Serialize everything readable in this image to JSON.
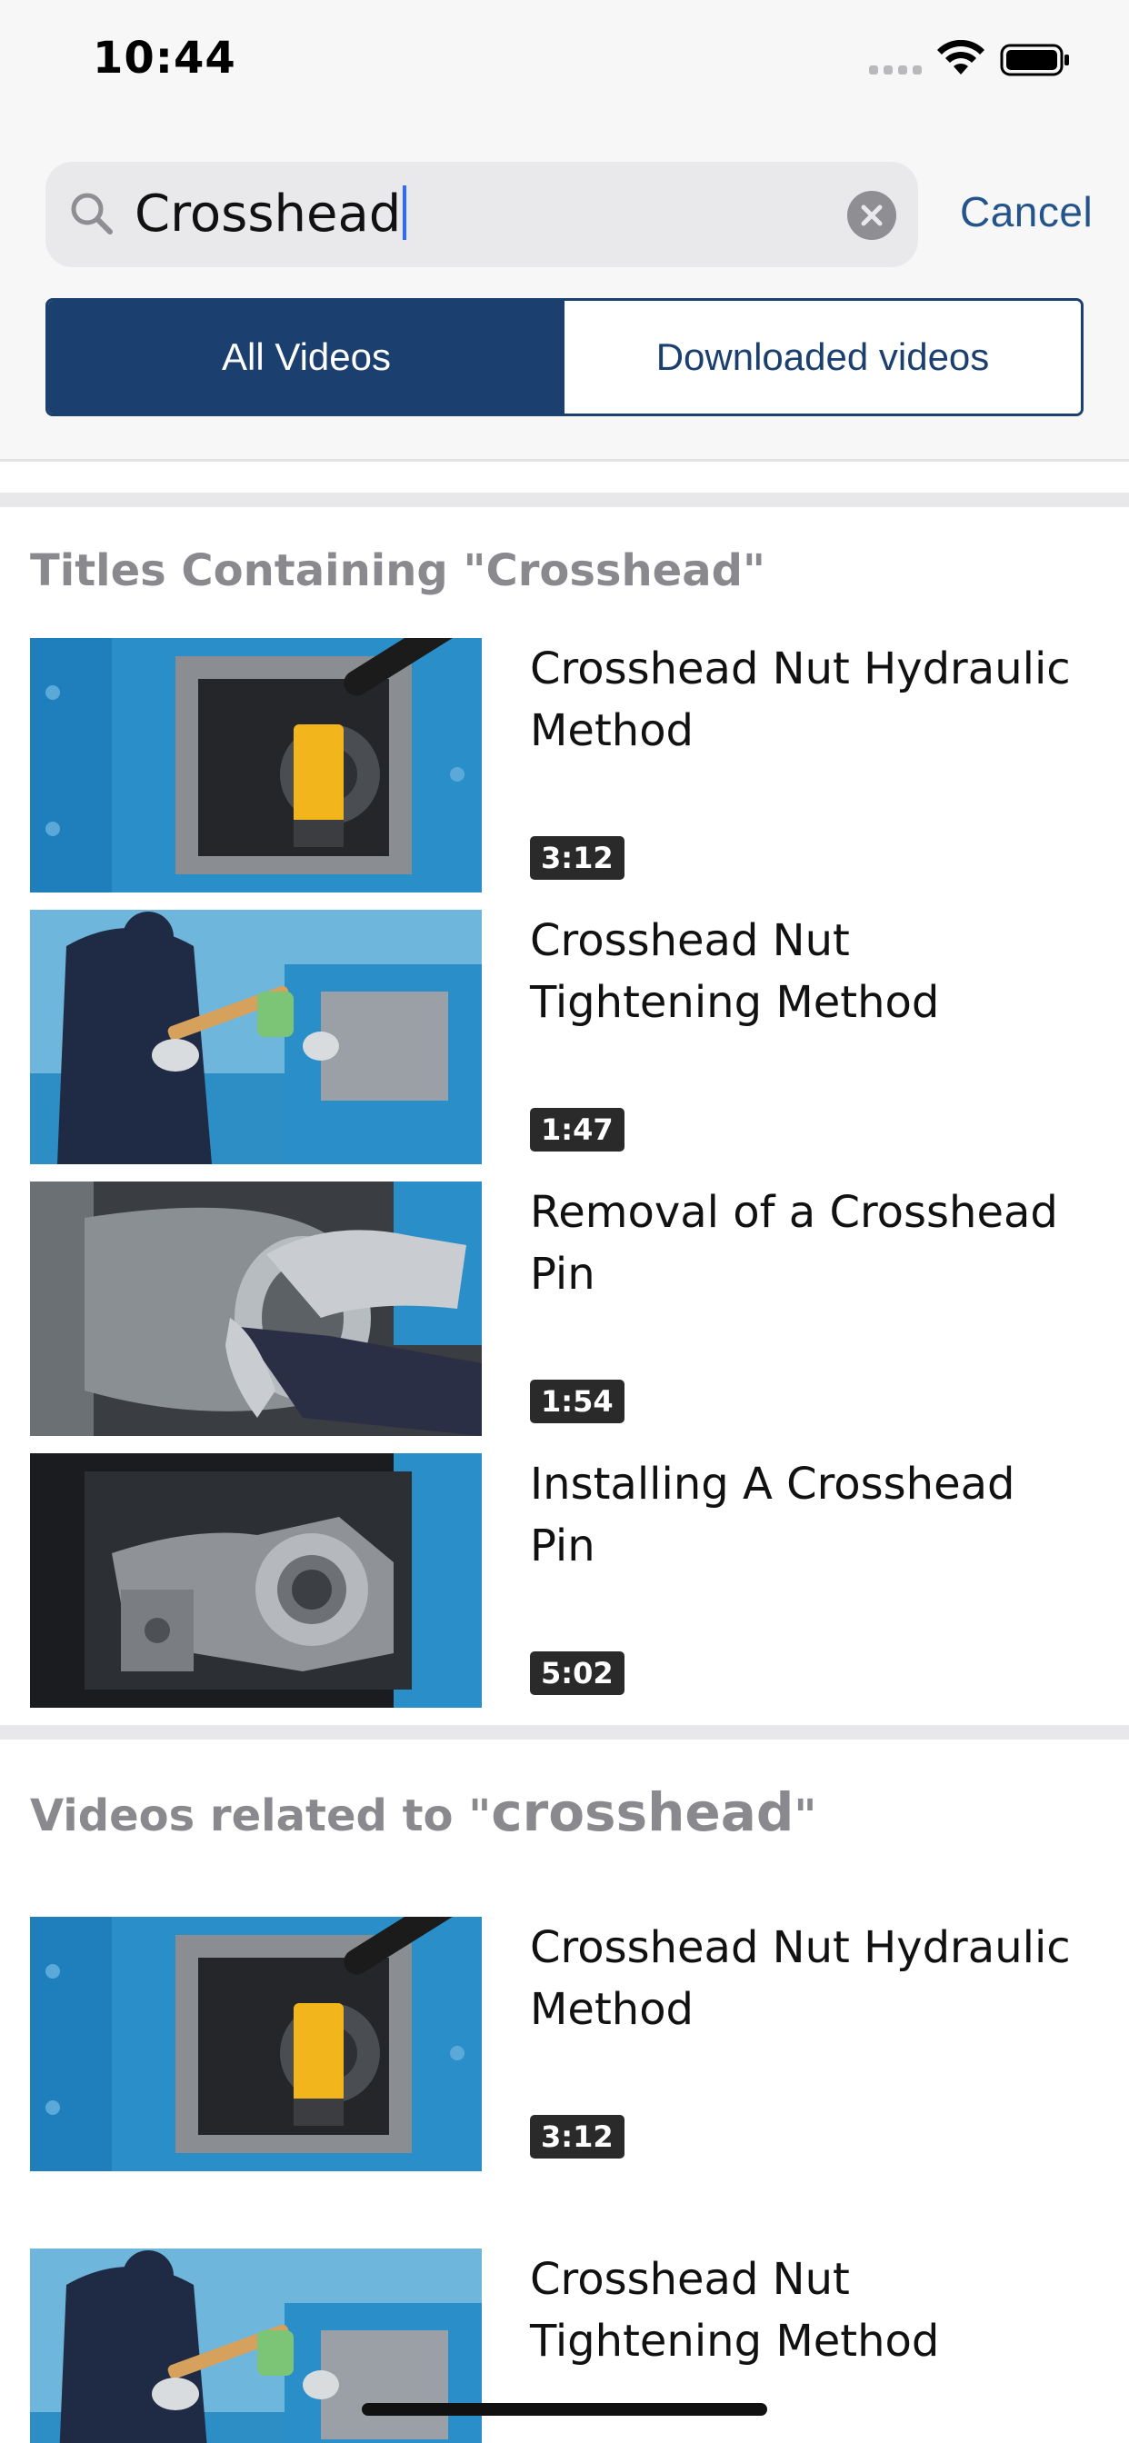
{
  "status_bar": {
    "time": "10:44"
  },
  "search": {
    "query": "Crosshead",
    "cancel_label": "Cancel"
  },
  "segments": [
    {
      "label": "All Videos",
      "selected": true
    },
    {
      "label": "Downloaded videos",
      "selected": false
    }
  ],
  "section_titles": {
    "heading": "Titles Containing \"Crosshead\"",
    "videos": [
      {
        "title": "Crosshead Nut Hydraulic Method",
        "duration": "3:12",
        "thumbnail_icon": "hydraulic-tool-thumbnail"
      },
      {
        "title": "Crosshead Nut Tightening Method",
        "duration": "1:47",
        "thumbnail_icon": "technician-hammer-thumbnail"
      },
      {
        "title": "Removal of a Crosshead Pin",
        "duration": "1:54",
        "thumbnail_icon": "gloved-hand-pin-thumbnail"
      },
      {
        "title": "Installing A Crosshead Pin",
        "duration": "5:02",
        "thumbnail_icon": "crosshead-assembly-thumbnail"
      }
    ]
  },
  "section_related": {
    "heading_prefix": "Videos related to \"",
    "heading_keyword": "crosshead",
    "heading_suffix": "\"",
    "videos": [
      {
        "title": "Crosshead Nut Hydraulic Method",
        "duration": "3:12",
        "thumbnail_icon": "hydraulic-tool-thumbnail"
      },
      {
        "title": "Crosshead Nut Tightening Method",
        "duration": "",
        "thumbnail_icon": "technician-hammer-thumbnail"
      }
    ]
  },
  "colors": {
    "brand_navy": "#1b3f6e",
    "link_blue": "#23548b",
    "machine_blue": "#2a8fc9",
    "caret_blue": "#2f6bff"
  }
}
